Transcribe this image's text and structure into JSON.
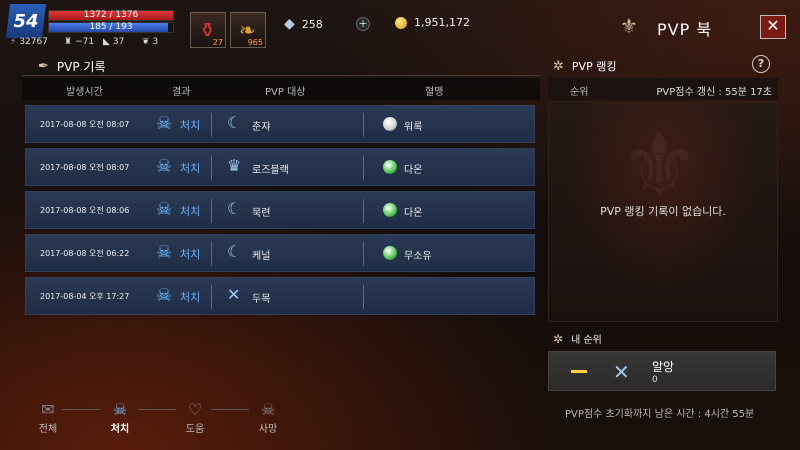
{
  "hud": {
    "level": "54",
    "hp_text": "1372 / 1376",
    "mp_text": "185 / 193",
    "hp_fraction": 0.997,
    "mp_fraction": 0.959,
    "stats": [
      {
        "icon": "lightning-icon",
        "value": "32767"
      },
      {
        "icon": "helmet-icon",
        "value": "−71"
      },
      {
        "icon": "boot-icon",
        "value": "37"
      },
      {
        "icon": "wing-icon",
        "value": "3"
      }
    ],
    "slots": [
      {
        "icon": "red-potion-icon",
        "count": "27"
      },
      {
        "icon": "leaf-scroll-icon",
        "count": "965"
      }
    ],
    "gems": "258",
    "gold": "1,951,172"
  },
  "title": "PVP 북",
  "left_panel": {
    "title": "PVP 기록",
    "columns": [
      "발생시간",
      "결과",
      "PVP 대상",
      "혈맹"
    ],
    "rows": [
      {
        "time": "2017-08-08 오전 08:07",
        "result": "처치",
        "target": "춘쟈",
        "class_icon": "ghost-class-icon",
        "guild": "워록",
        "guild_color": "#cfcfcf"
      },
      {
        "time": "2017-08-08 오전 08:07",
        "result": "처치",
        "target": "로즈블랙",
        "class_icon": "crown-class-icon",
        "guild": "다온",
        "guild_color": "#4fc44f"
      },
      {
        "time": "2017-08-08 오전 08:06",
        "result": "처치",
        "target": "묵련",
        "class_icon": "ghost-class-icon",
        "guild": "다온",
        "guild_color": "#4fc44f"
      },
      {
        "time": "2017-08-08 오전 06:22",
        "result": "처치",
        "target": "케널",
        "class_icon": "ghost-class-icon",
        "guild": "무소유",
        "guild_color": "#4fc44f"
      },
      {
        "time": "2017-08-04 오후 17:27",
        "result": "처치",
        "target": "두목",
        "class_icon": "cross-class-icon",
        "guild": "",
        "guild_color": ""
      }
    ]
  },
  "tabs": [
    {
      "label": "전체",
      "icon": "scroll-icon",
      "active": false
    },
    {
      "label": "처치",
      "icon": "skull-icon",
      "active": true
    },
    {
      "label": "도움",
      "icon": "assist-icon",
      "active": false
    },
    {
      "label": "사망",
      "icon": "death-skull-icon",
      "active": false
    }
  ],
  "reset_time": "PVP점수 초기화까지 남은 시간 : 4시간 55분",
  "right_panel": {
    "title": "PVP 랭킹",
    "rank_col": "순위",
    "update_text": "PVP점수 갱신 : 55분 17초",
    "empty_msg": "PVP 랭킹 기록이 없습니다.",
    "my_rank_title": "내 순위",
    "my_rank_value": "—",
    "my_name": "알앙",
    "my_score": "0"
  },
  "colors": {
    "row_bg": "#2b3a55",
    "accent_blue": "#6ab0ff",
    "hp_red": "#e03a3a",
    "mp_blue": "#4b7de8"
  }
}
